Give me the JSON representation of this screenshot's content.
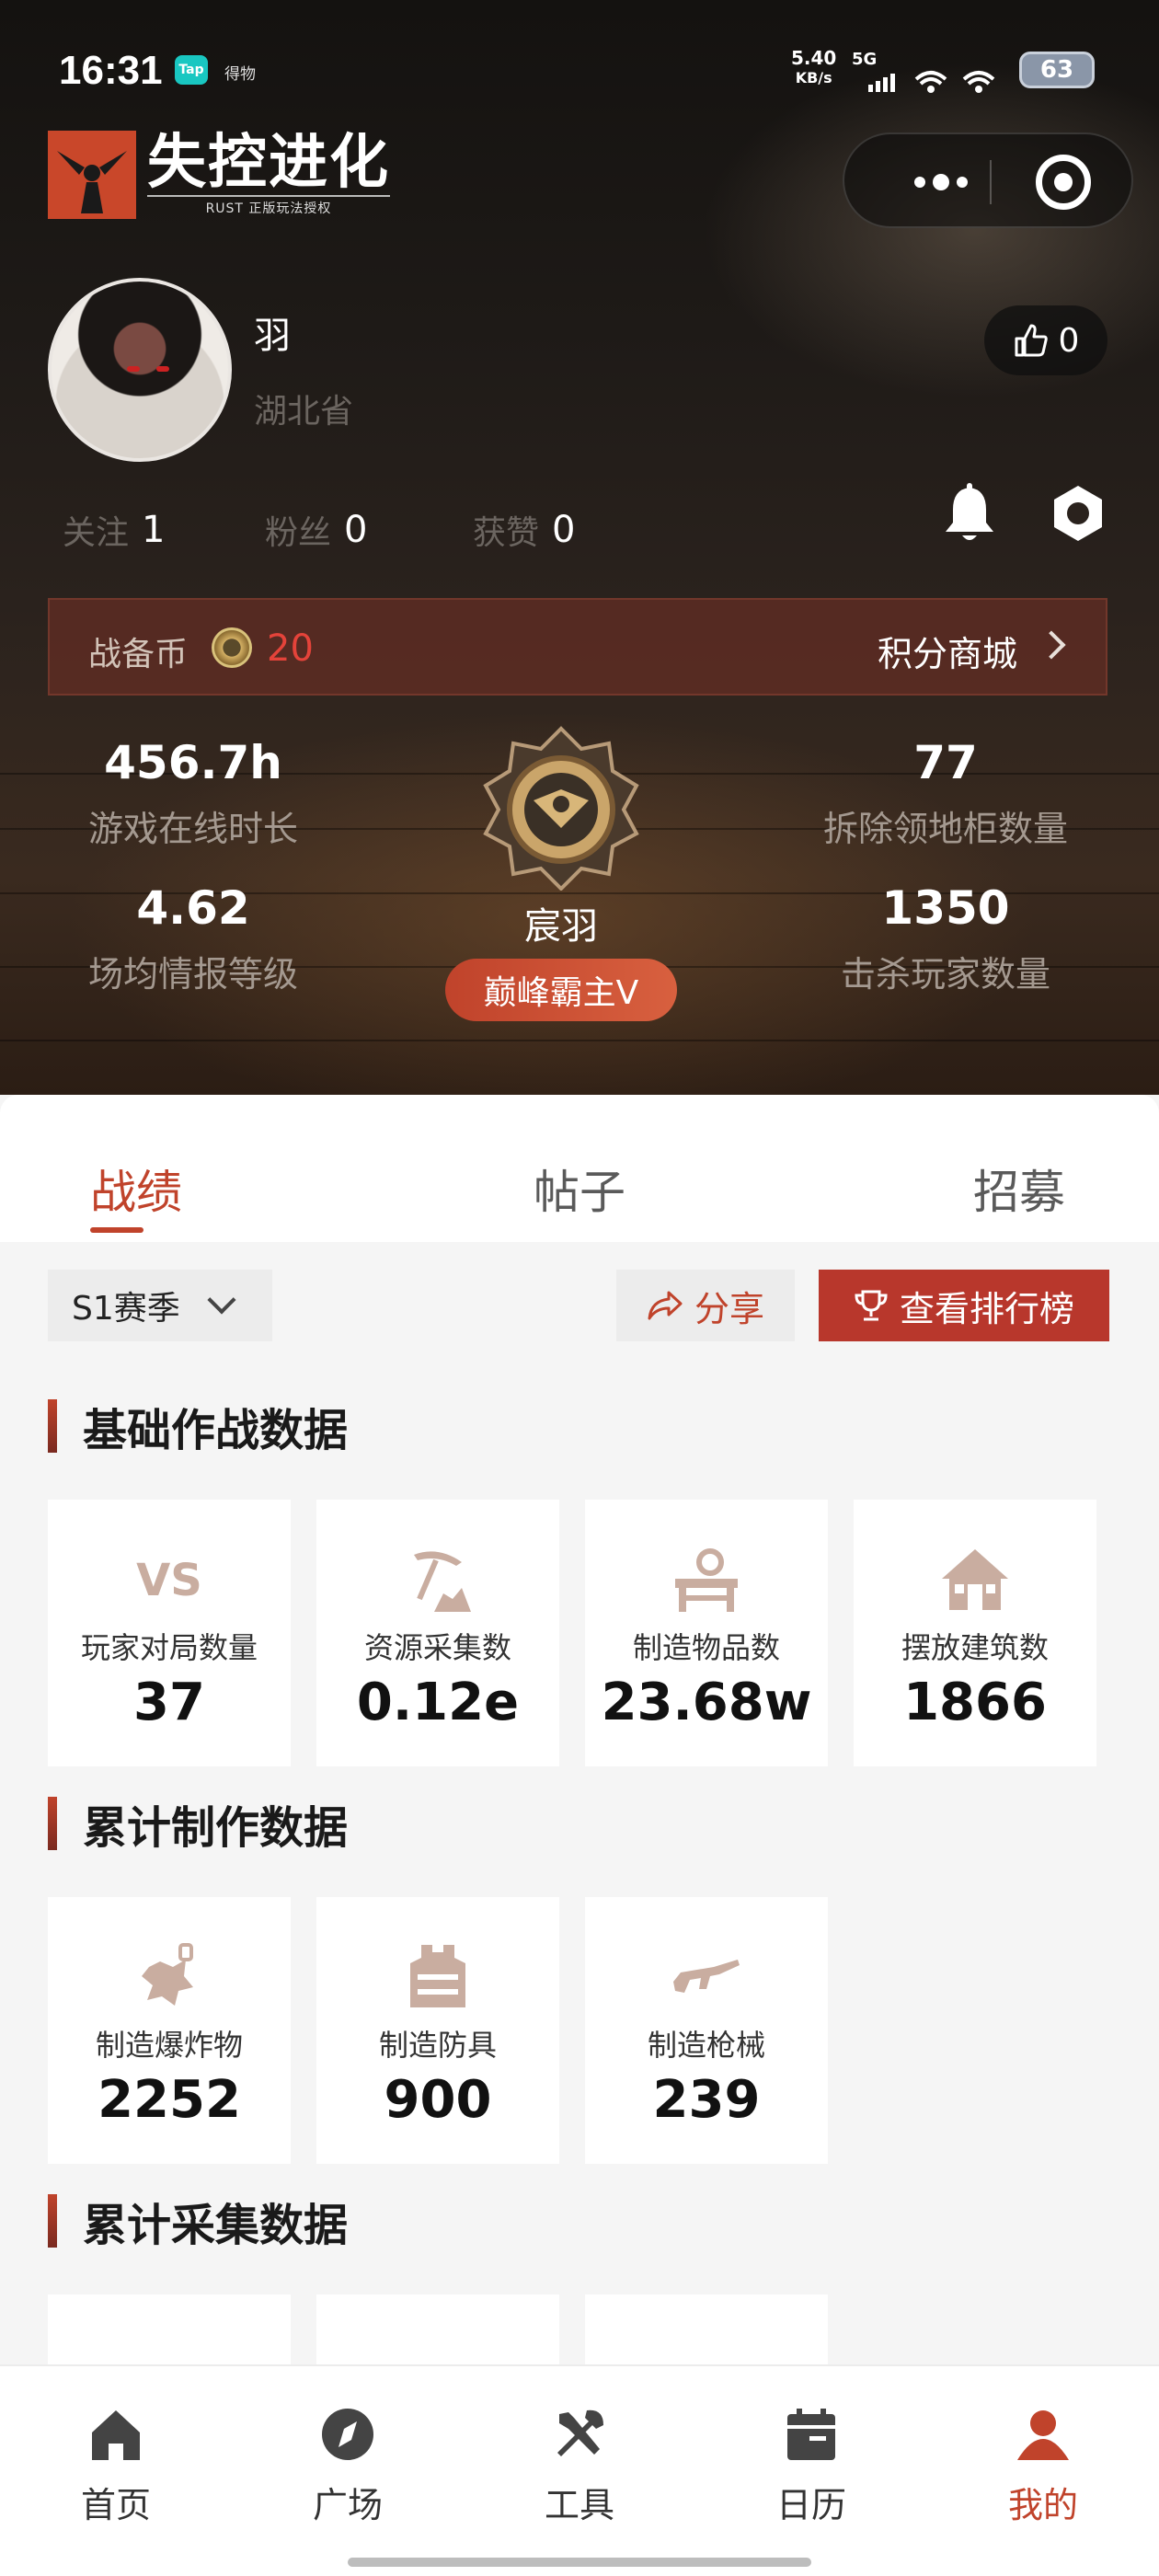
{
  "status_bar": {
    "time": "16:31",
    "tap_badge": "Tap",
    "app_label": "得物",
    "net_speed_value": "5.40",
    "net_speed_unit": "KB/s",
    "net_type": "5G",
    "battery": "63"
  },
  "app": {
    "logo_title": "失控进化",
    "logo_subtitle": "RUST 正版玩法授权"
  },
  "profile": {
    "username": "羽",
    "region": "湖北省",
    "likes": "0",
    "follow_label": "关注",
    "follow_count": "1",
    "fans_label": "粉丝",
    "fans_count": "0",
    "liked_label": "获赞",
    "liked_count": "0"
  },
  "coin": {
    "label": "战备币",
    "value": "20",
    "mall_label": "积分商城"
  },
  "stats": {
    "online_value": "456.7h",
    "online_label": "游戏在线时长",
    "intel_value": "4.62",
    "intel_label": "场均情报等级",
    "cabinet_value": "77",
    "cabinet_label": "拆除领地柜数量",
    "kills_value": "1350",
    "kills_label": "击杀玩家数量"
  },
  "rank": {
    "name": "宸羽",
    "tier": "巅峰霸主V"
  },
  "tabs": [
    {
      "label": "战绩",
      "active": true
    },
    {
      "label": "帖子",
      "active": false
    },
    {
      "label": "招募",
      "active": false
    }
  ],
  "toolbar": {
    "season": "S1赛季",
    "share_label": "分享",
    "ranking_label": "查看排行榜"
  },
  "sections": {
    "basic_title": "基础作战数据",
    "craft_title": "累计制作数据",
    "gather_title": "累计采集数据"
  },
  "basic_cards": [
    {
      "label": "玩家对局数量",
      "value": "37",
      "icon": "vs-icon"
    },
    {
      "label": "资源采集数",
      "value": "0.12e",
      "icon": "pickaxe-icon"
    },
    {
      "label": "制造物品数",
      "value": "23.68w",
      "icon": "workbench-icon"
    },
    {
      "label": "摆放建筑数",
      "value": "1866",
      "icon": "house-icon"
    }
  ],
  "craft_cards": [
    {
      "label": "制造爆炸物",
      "value": "2252",
      "icon": "explosive-icon"
    },
    {
      "label": "制造防具",
      "value": "900",
      "icon": "armor-icon"
    },
    {
      "label": "制造枪械",
      "value": "239",
      "icon": "rifle-icon"
    }
  ],
  "nav": [
    {
      "label": "首页",
      "icon": "home-icon",
      "active": false
    },
    {
      "label": "广场",
      "icon": "compass-icon",
      "active": false
    },
    {
      "label": "工具",
      "icon": "tools-icon",
      "active": false
    },
    {
      "label": "日历",
      "icon": "calendar-icon",
      "active": false
    },
    {
      "label": "我的",
      "icon": "user-icon",
      "active": true
    }
  ],
  "colors": {
    "accent": "#c0432b",
    "accent_dark": "#b8372c",
    "coin_value": "#e4433a",
    "icon_tan": "#c9ada0"
  }
}
